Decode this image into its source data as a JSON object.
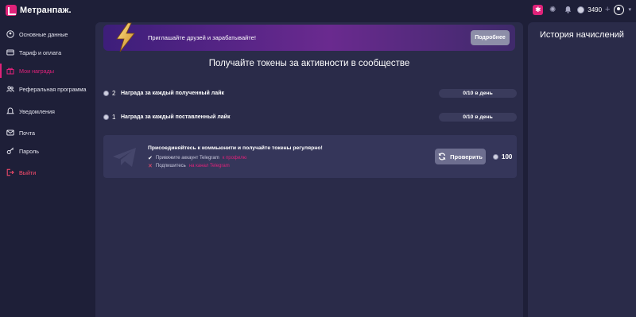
{
  "app": {
    "logo_text": "Метранпаж."
  },
  "header": {
    "balance": "3490",
    "gift_icon": "gift-icon",
    "theme_icon": "theme-toggle-icon",
    "bell_icon": "bell-icon",
    "coin_icon": "coin-icon",
    "plus_icon": "plus-icon",
    "avatar_icon": "user-avatar-icon"
  },
  "sidebar": {
    "items": [
      {
        "label": "Основные данные",
        "icon": "user-icon"
      },
      {
        "label": "Тариф и оплата",
        "icon": "card-icon"
      },
      {
        "label": "Мои награды",
        "icon": "gift-icon",
        "active": true
      },
      {
        "label": "Реферальная программа",
        "icon": "users-icon"
      },
      {
        "label": "Уведомления",
        "icon": "bell-icon"
      },
      {
        "label": "Почта",
        "icon": "mail-icon"
      },
      {
        "label": "Пароль",
        "icon": "key-icon"
      },
      {
        "label": "Выйти",
        "icon": "logout-icon"
      }
    ]
  },
  "banner": {
    "text": "Приглашайте друзей и зарабатывайте!",
    "button": "Подробнее"
  },
  "main": {
    "title": "Получайте токены за активности в сообществе",
    "rewards": [
      {
        "amount": "2",
        "label": "Награда за каждый полученный лайк",
        "progress": "0/10 в день"
      },
      {
        "amount": "1",
        "label": "Награда за каждый поставленный лайк",
        "progress": "0/10 в день"
      }
    ],
    "telegram": {
      "title": "Присоединяйтесь к коммьюнити и получайте токены регулярно!",
      "step1_text": "Привяжите аккаунт Telegram",
      "step1_link": "к профилю",
      "step2_text": "Подпишитесь",
      "step2_link": "на канал Telegram",
      "button": "Проверить",
      "reward": "100"
    }
  },
  "history": {
    "title": "История начислений"
  },
  "colors": {
    "accent": "#e0227a",
    "bg": "#1e1f38",
    "panel": "#2a2b49",
    "card": "#35365a"
  }
}
